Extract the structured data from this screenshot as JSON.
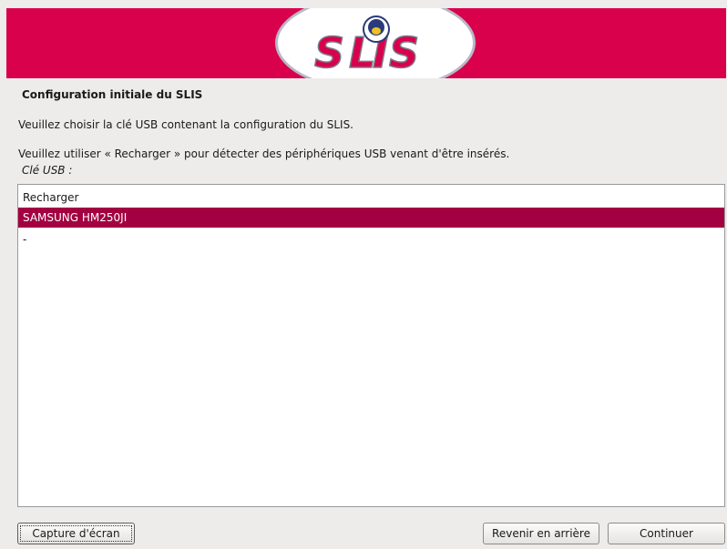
{
  "header": {
    "logo_text": "SLIS"
  },
  "page": {
    "title": "Configuration initiale du SLIS",
    "line1": "Veuillez choisir la clé USB contenant la configuration du SLIS.",
    "line2": "Veuillez utiliser « Recharger » pour détecter des périphériques USB venant d'être insérés.",
    "field_label": "Clé USB :"
  },
  "usb_list": {
    "items": [
      "Recharger",
      "SAMSUNG HM250JI",
      "-"
    ],
    "selected_index": 1
  },
  "buttons": {
    "screenshot": "Capture d'écran",
    "back": "Revenir en arrière",
    "continue": "Continuer"
  },
  "colors": {
    "banner": "#d9004c",
    "selection": "#a30042"
  }
}
